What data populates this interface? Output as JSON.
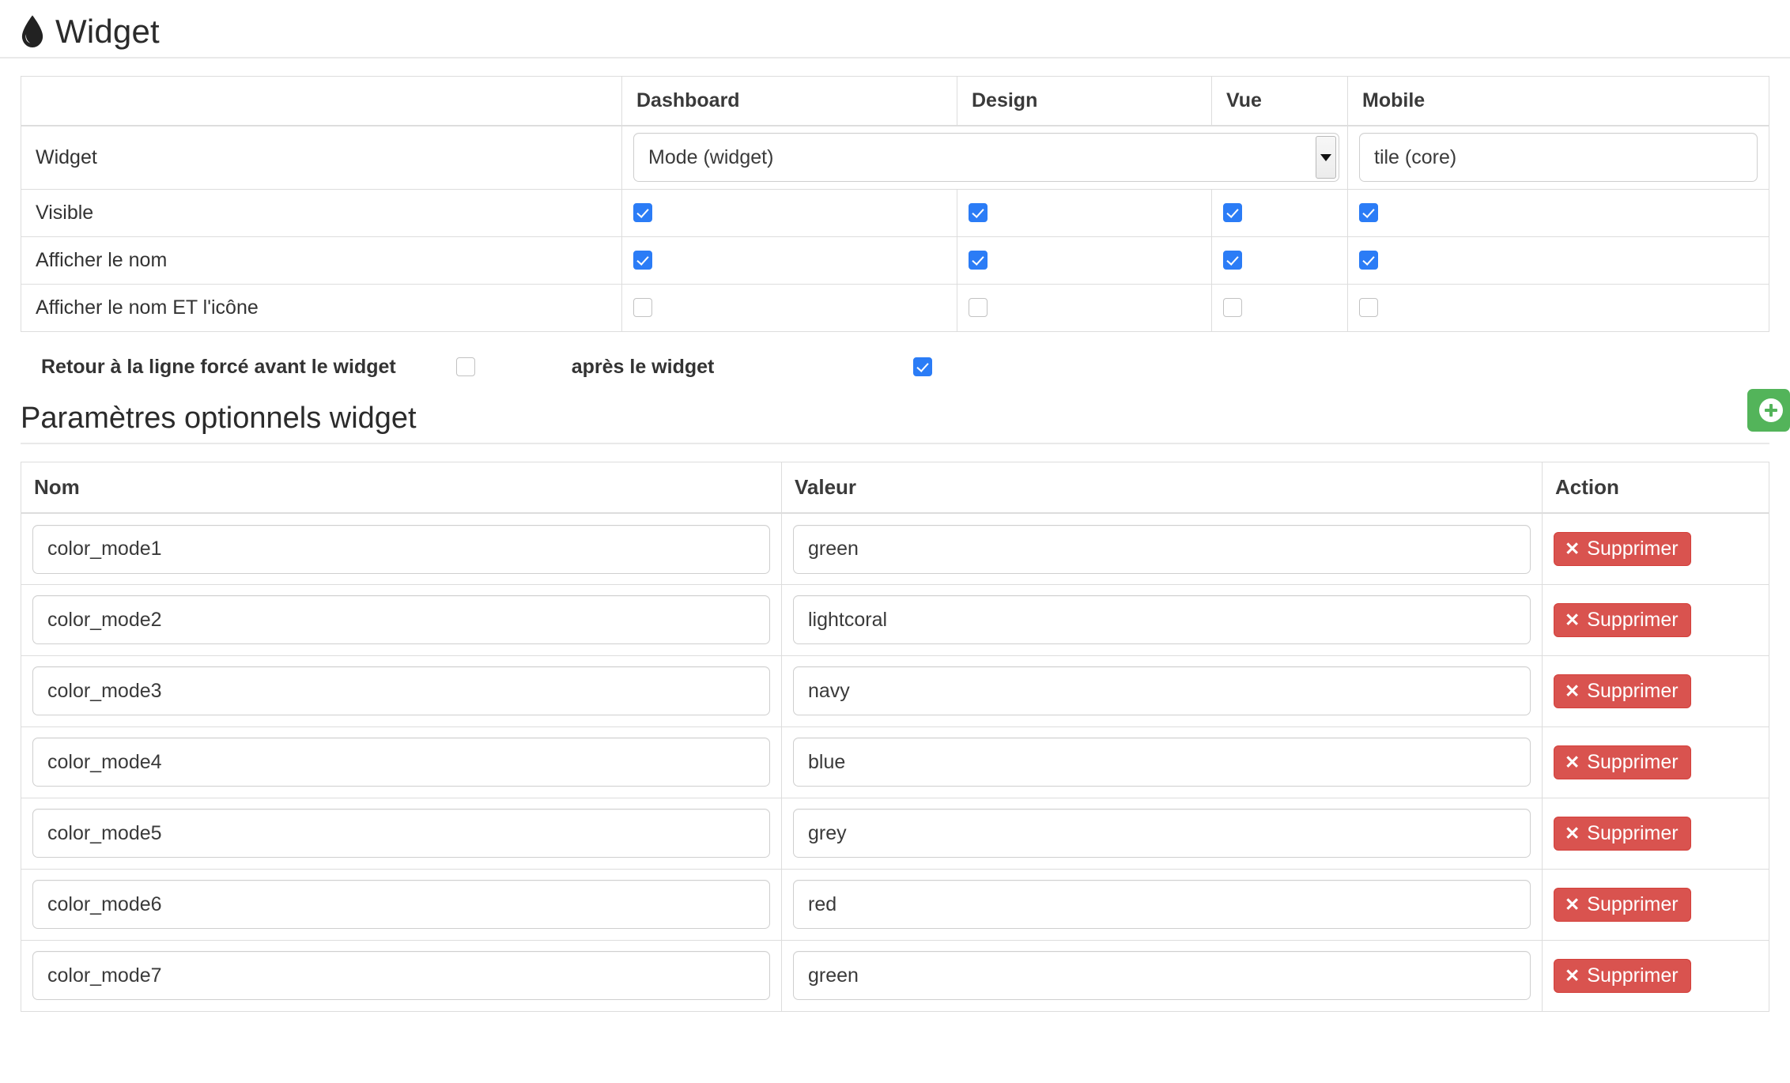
{
  "header": {
    "title": "Widget",
    "icon": "tint-drop-icon"
  },
  "config_table": {
    "columns": [
      "",
      "Dashboard",
      "Design",
      "Vue",
      "Mobile"
    ],
    "rows": [
      {
        "label": "Widget",
        "type": "controls",
        "select_value": "Mode (widget)",
        "mobile_value": "tile (core)"
      },
      {
        "label": "Visible",
        "type": "checkboxes",
        "dashboard": true,
        "design": true,
        "vue": true,
        "mobile": true
      },
      {
        "label": "Afficher le nom",
        "type": "checkboxes",
        "dashboard": true,
        "design": true,
        "vue": true,
        "mobile": true
      },
      {
        "label": "Afficher le nom ET l'icône",
        "type": "checkboxes",
        "dashboard": false,
        "design": false,
        "vue": false,
        "mobile": false
      }
    ]
  },
  "line_break": {
    "before_label": "Retour à la ligne forcé avant le widget",
    "before_checked": false,
    "after_label": "après le widget",
    "after_checked": true
  },
  "params_section": {
    "title": "Paramètres optionnels widget",
    "add_button_icon": "plus-circle-icon",
    "columns": [
      "Nom",
      "Valeur",
      "Action"
    ],
    "delete_label": "Supprimer",
    "delete_icon": "✕",
    "rows": [
      {
        "nom": "color_mode1",
        "valeur": "green"
      },
      {
        "nom": "color_mode2",
        "valeur": "lightcoral"
      },
      {
        "nom": "color_mode3",
        "valeur": "navy"
      },
      {
        "nom": "color_mode4",
        "valeur": "blue"
      },
      {
        "nom": "color_mode5",
        "valeur": "grey"
      },
      {
        "nom": "color_mode6",
        "valeur": "red"
      },
      {
        "nom": "color_mode7",
        "valeur": "green"
      }
    ]
  },
  "colors": {
    "checkbox_on": "#2b7cf6",
    "delete_button": "#d9534f",
    "add_button": "#53b45a",
    "border": "#dddddd",
    "text": "#333333"
  }
}
